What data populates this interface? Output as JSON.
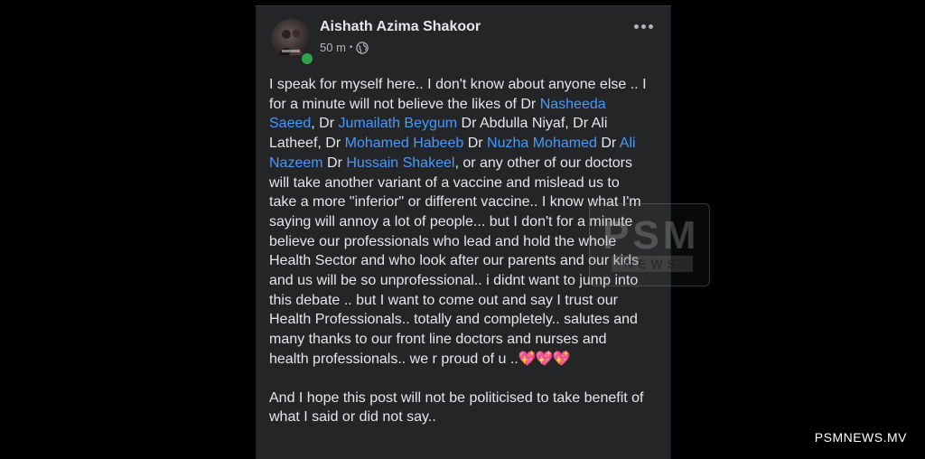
{
  "post": {
    "author_name": "Aishath Azima Shakoor",
    "time": "50 m",
    "separator": "•",
    "privacy_icon": "globe-icon",
    "more_icon": "more-options-icon",
    "status_color": "#31a24c",
    "link_color": "#4599ff",
    "text": {
      "p1": {
        "s1": "I speak for myself here.. I don't know about anyone else .. I for a minute will not believe the likes of Dr ",
        "m1": "Nasheeda Saeed",
        "s2": ", Dr ",
        "m2": "Jumailath Beygum",
        "s3": "  Dr Abdulla Niyaf, Dr Ali Latheef, Dr ",
        "m3": "Mohamed Habeeb",
        "s4": "  Dr ",
        "m4": "Nuzha Mohamed",
        "s5": " Dr ",
        "m5": "Ali Nazeem",
        "s6": "  Dr ",
        "m6": "Hussain Shakeel",
        "s7": ",  or any other of our doctors will take another variant of a vaccine and mislead us to take a more \"inferior\" or different vaccine.. I know what I'm saying will annoy a lot of people... but I don't for a minute believe  our professionals who lead and hold the whole Health Sector and who look after our parents and our kids and us will be so unprofessional.. i didnt want to jump into this debate .. but I want to come out and say I trust our Health Professionals.. totally and completely.. salutes and many thanks to our front line doctors and nurses and health professionals.. we r proud of u ..",
        "emoji": "💖💖💖"
      },
      "p2": "And I hope this post will not be politicised to take benefit of what I said or did not say.."
    }
  },
  "watermark": {
    "brand": "PSM",
    "sub": "NEWS"
  },
  "site_label": "PSMNEWS.MV"
}
